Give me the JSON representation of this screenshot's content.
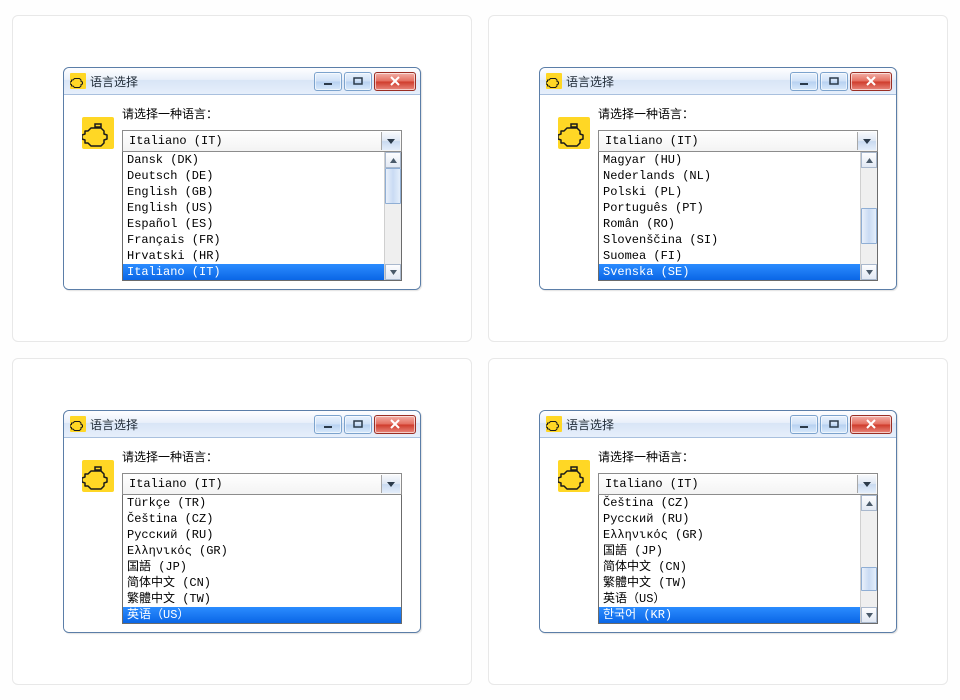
{
  "dialogs": [
    {
      "title": "语言选择",
      "prompt": "请选择一种语言：",
      "selected": "Italiano (IT)",
      "scroll": {
        "thumbTop": 0,
        "thumbHeight": 34
      },
      "items": [
        {
          "label": "Dansk (DK)",
          "sel": false
        },
        {
          "label": "Deutsch (DE)",
          "sel": false
        },
        {
          "label": "English (GB)",
          "sel": false
        },
        {
          "label": "English (US)",
          "sel": false
        },
        {
          "label": "Español (ES)",
          "sel": false
        },
        {
          "label": "Français (FR)",
          "sel": false
        },
        {
          "label": "Hrvatski (HR)",
          "sel": false
        },
        {
          "label": "Italiano (IT)",
          "sel": true
        }
      ]
    },
    {
      "title": "语言选择",
      "prompt": "请选择一种语言：",
      "selected": "Italiano (IT)",
      "scroll": {
        "thumbTop": 40,
        "thumbHeight": 34
      },
      "items": [
        {
          "label": "Magyar (HU)",
          "sel": false
        },
        {
          "label": "Nederlands (NL)",
          "sel": false
        },
        {
          "label": "Polski (PL)",
          "sel": false
        },
        {
          "label": "Português (PT)",
          "sel": false
        },
        {
          "label": "Român (RO)",
          "sel": false
        },
        {
          "label": "Slovenščina (SI)",
          "sel": false
        },
        {
          "label": "Suomea (FI)",
          "sel": false
        },
        {
          "label": "Svenska (SE)",
          "sel": true
        }
      ]
    },
    {
      "title": "语言选择",
      "prompt": "请选择一种语言：",
      "selected": "Italiano (IT)",
      "scroll": null,
      "items": [
        {
          "label": "Türkçe (TR)",
          "sel": false
        },
        {
          "label": "Čeština (CZ)",
          "sel": false
        },
        {
          "label": "Русский (RU)",
          "sel": false
        },
        {
          "label": "Ελληνικός (GR)",
          "sel": false
        },
        {
          "label": "国語 (JP)",
          "sel": false
        },
        {
          "label": "简体中文 (CN)",
          "sel": false
        },
        {
          "label": "繁體中文 (TW)",
          "sel": false
        },
        {
          "label": "英语（US）",
          "sel": true
        }
      ]
    },
    {
      "title": "语言选择",
      "prompt": "请选择一种语言：",
      "selected": "Italiano (IT)",
      "scroll": {
        "thumbTop": 56,
        "thumbHeight": 22
      },
      "items": [
        {
          "label": "Čeština (CZ)",
          "sel": false
        },
        {
          "label": "Русский (RU)",
          "sel": false
        },
        {
          "label": "Ελληνικός (GR)",
          "sel": false
        },
        {
          "label": "国語 (JP)",
          "sel": false
        },
        {
          "label": "简体中文 (CN)",
          "sel": false
        },
        {
          "label": "繁體中文 (TW)",
          "sel": false
        },
        {
          "label": "英语（US）",
          "sel": false
        },
        {
          "label": "한국어 (KR)",
          "sel": true
        }
      ]
    }
  ]
}
